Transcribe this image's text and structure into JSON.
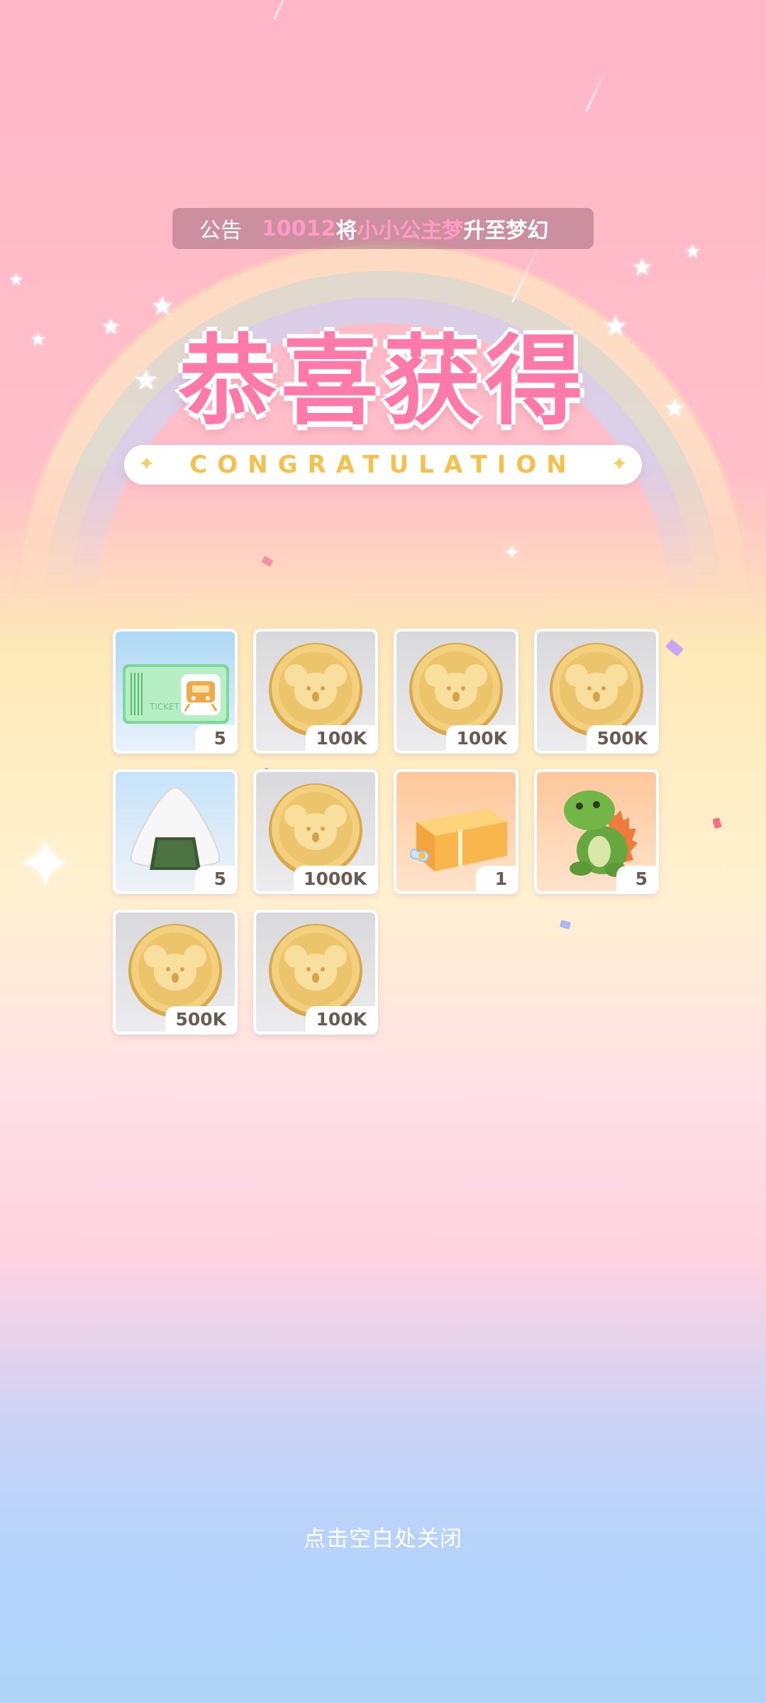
{
  "announcement": {
    "label": "公告",
    "user_id": "10012",
    "text_1": "将",
    "item_name": "小小公主梦",
    "text_2": "升至梦幻"
  },
  "title": "恭喜获得",
  "subtitle": "CONGRATULATION",
  "rewards": [
    {
      "icon": "ticket-icon",
      "qty": "5"
    },
    {
      "icon": "koala-coin-icon",
      "qty": "100K"
    },
    {
      "icon": "koala-coin-icon",
      "qty": "100K"
    },
    {
      "icon": "koala-coin-icon",
      "qty": "500K"
    },
    {
      "icon": "rice-ball-icon",
      "qty": "5"
    },
    {
      "icon": "koala-coin-icon",
      "qty": "1000K"
    },
    {
      "icon": "gift-box-icon",
      "qty": "1"
    },
    {
      "icon": "dinosaur-plush-icon",
      "qty": "5"
    },
    {
      "icon": "koala-coin-icon",
      "qty": "500K"
    },
    {
      "icon": "koala-coin-icon",
      "qty": "100K"
    }
  ],
  "close_hint": "点击空白处关闭",
  "colors": {
    "title_pink": "#ff7aa8",
    "subtitle_gold": "#f2c14e",
    "coin_gold": "#e9c26a"
  }
}
